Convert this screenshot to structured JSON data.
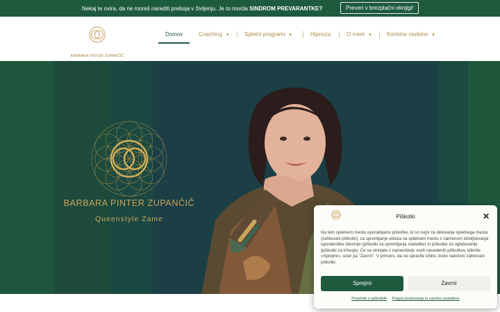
{
  "topbar": {
    "text_prefix": "Nekaj te ovira, da ne moreš narediti preboja v življenju. Je to morda ",
    "text_bold": "SINDROM PREVARANTKE?",
    "cta": "Preveri v brezplačni eknjigi!"
  },
  "header": {
    "logo_text": "BARBARA PINTER ZUPANČIČ",
    "nav": [
      {
        "label": "Domov"
      },
      {
        "label": "Coaching"
      },
      {
        "label": "Spletni programi"
      },
      {
        "label": "Hipnoza"
      },
      {
        "label": "O meni"
      },
      {
        "label": "Koristne vsebine"
      }
    ]
  },
  "hero": {
    "name": "BARBARA PINTER ZUPANČIČ",
    "subtitle": "Queenstyle Zame"
  },
  "cookie": {
    "title": "Piškotki",
    "body": "Na tem spletnem mestu uporabljamo piškotke, ki so nujni za delovanje spletnega mesta (zahtevani piškotki), za spremljanje obiska na spletnem mestu z namenom izboljševanja uporabniške izkušnje (piškotki za spremljanje statistike) in piškotke za oglaševanje (piškotki za trženje). Če se strinjate z namestitvijo vseh navedenih piškotkov, kliknite »Sprejmi«, sicer pa \"Zavrni\". V primeru, da ne opravite izbire, bodo naloženi zahtevani piškotki.",
    "accept": "Sprejmi",
    "deny": "Zavrni",
    "link_cookies": "Pravilnik o piškotkih",
    "link_terms": "Pogoji poslovanja in varstvo podatkov"
  },
  "colors": {
    "brand_green": "#1e5a3e",
    "gold": "#c9a45c"
  },
  "icons": {
    "logo": "rings-logo-icon",
    "close": "close-icon",
    "caret": "chevron-down-icon"
  }
}
